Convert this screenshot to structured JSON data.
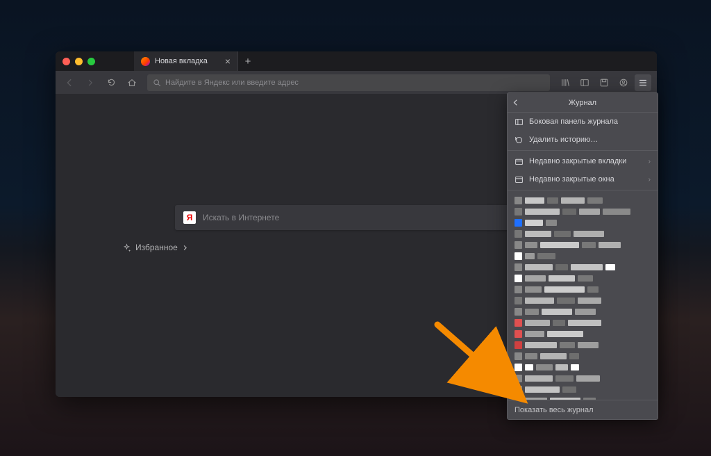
{
  "tab": {
    "title": "Новая вкладка"
  },
  "urlbar": {
    "placeholder": "Найдите в Яндекс или введите адрес"
  },
  "content": {
    "search_placeholder": "Искать в Интернете",
    "favorites_label": "Избранное",
    "yandex_y": "Я"
  },
  "panel": {
    "title": "Журнал",
    "items": {
      "sidebar": "Боковая панель журнала",
      "clear": "Удалить историю…",
      "closed_tabs": "Недавно закрытые вкладки",
      "closed_windows": "Недавно закрытые окна"
    },
    "footer": "Показать весь журнал"
  }
}
